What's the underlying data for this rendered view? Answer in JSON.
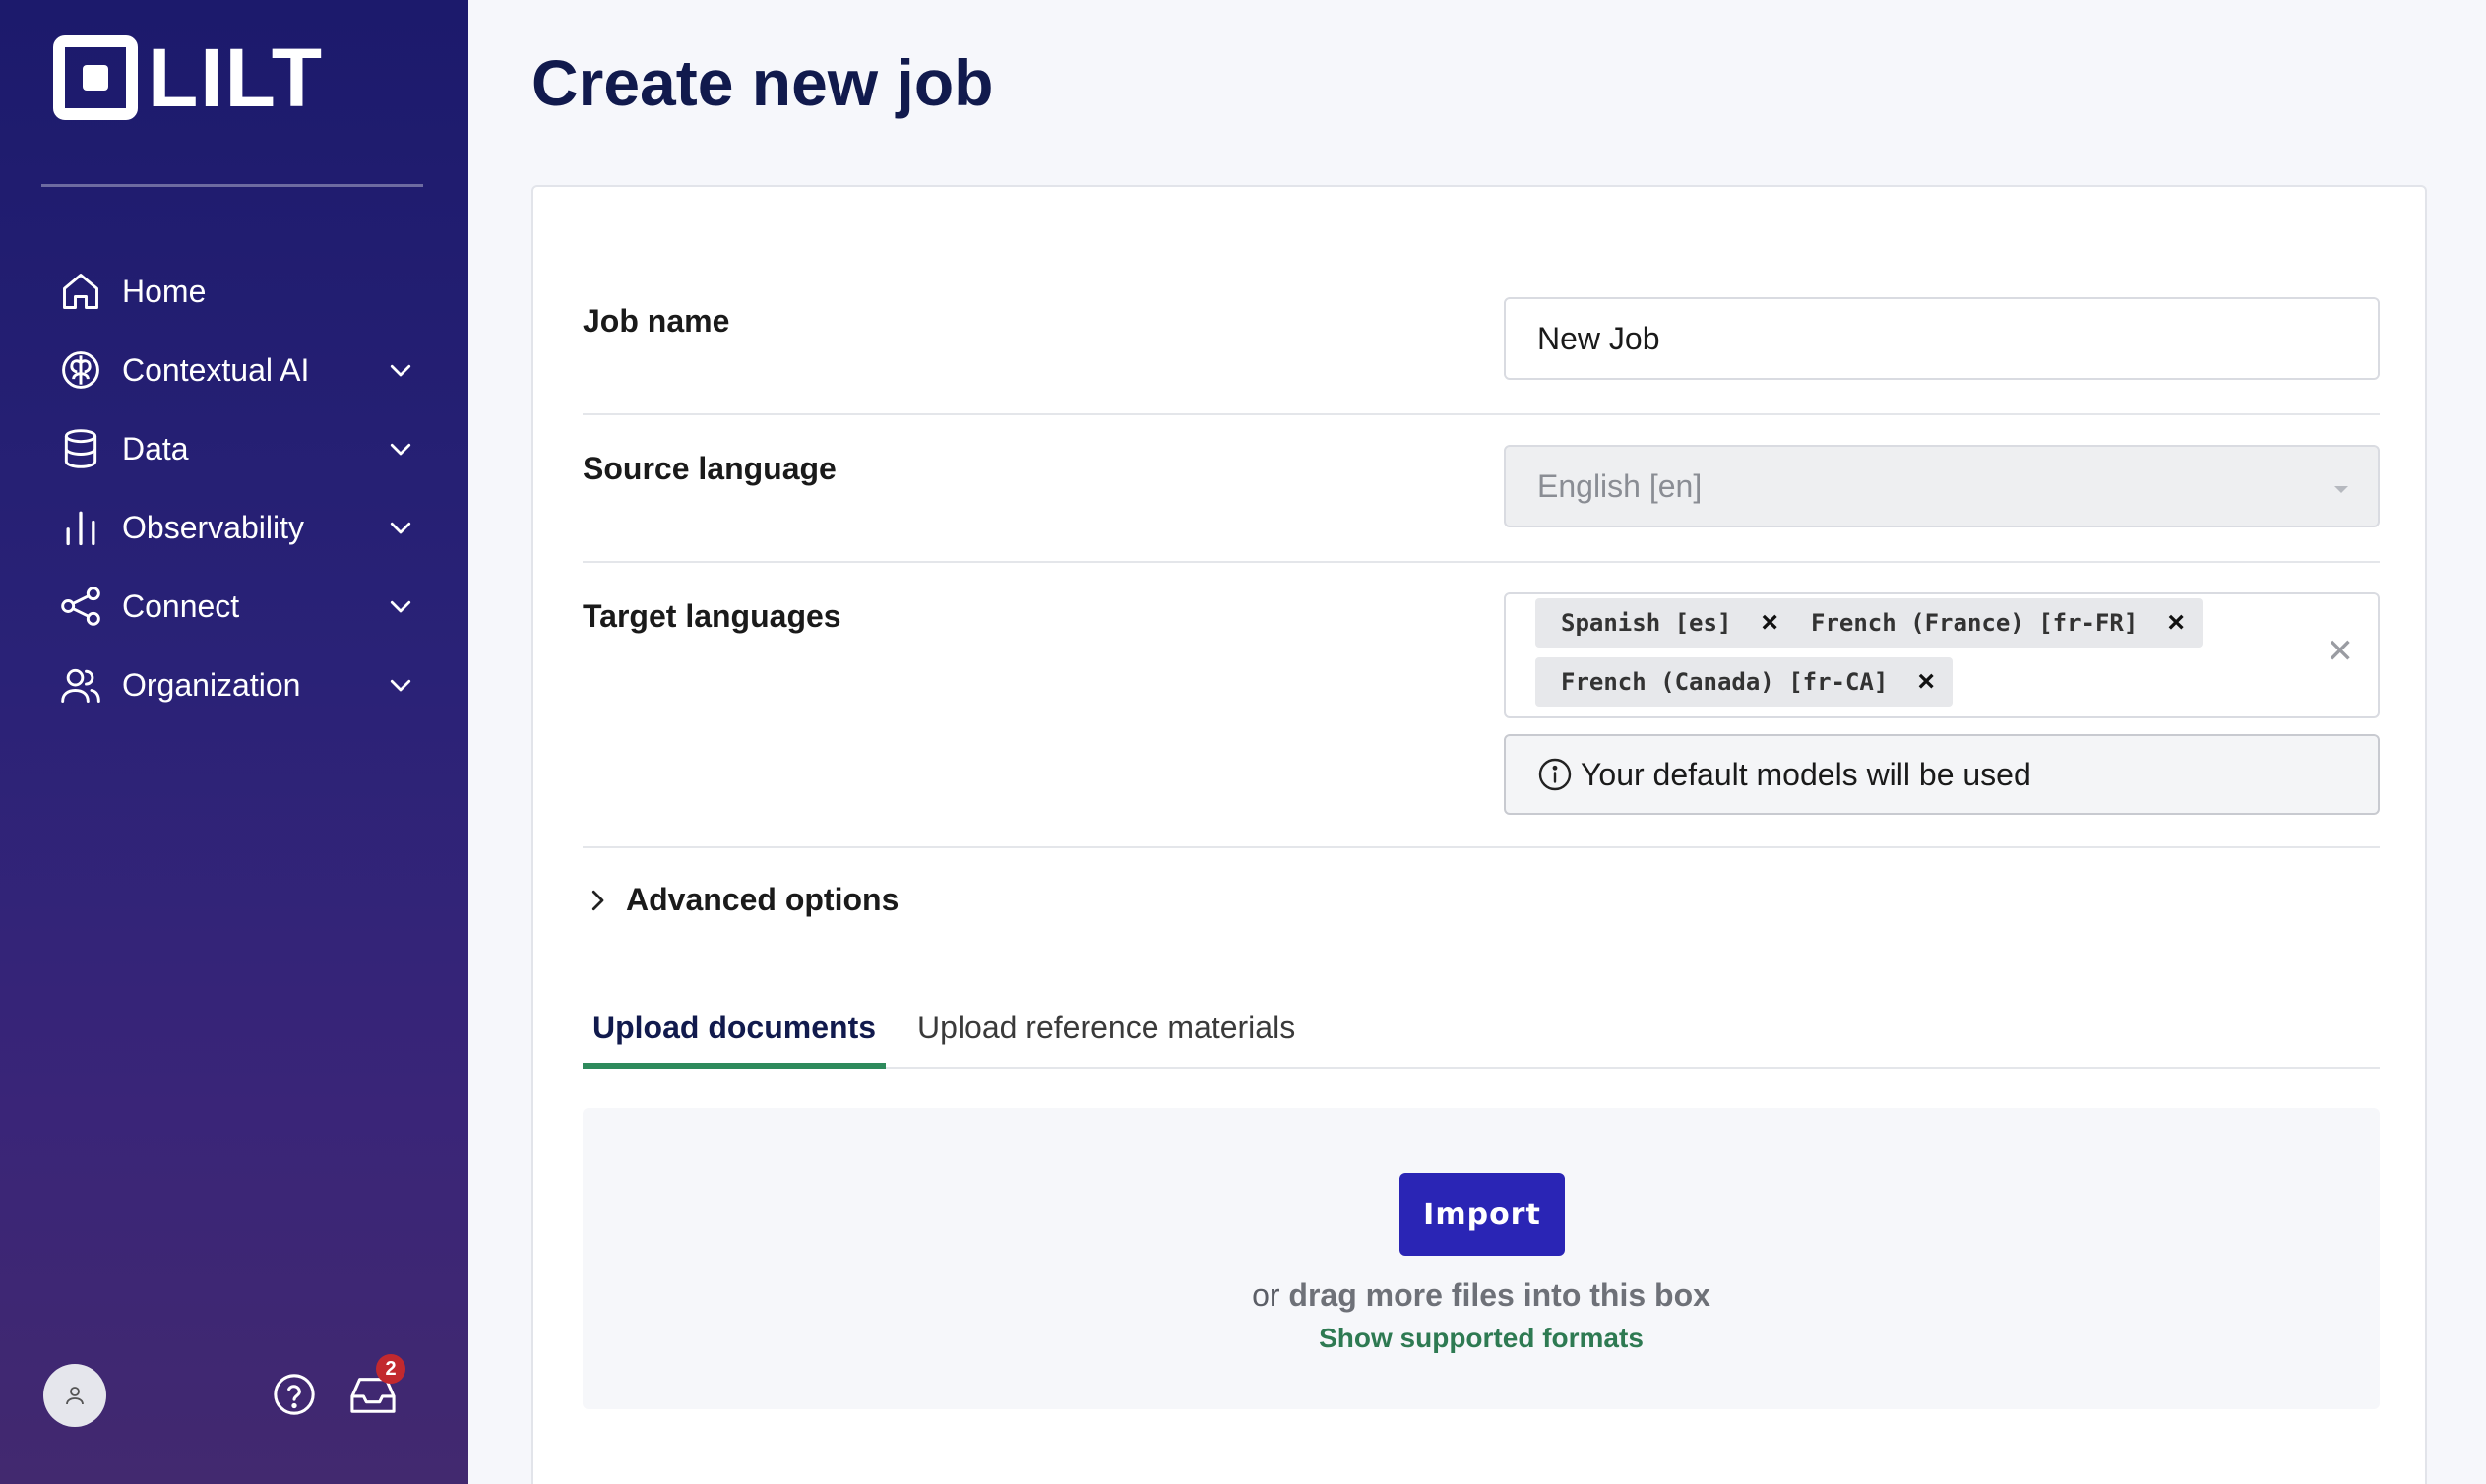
{
  "sidebar": {
    "logo_text": "LILT",
    "items": [
      {
        "label": "Home",
        "icon": "home-icon",
        "expandable": false
      },
      {
        "label": "Contextual AI",
        "icon": "brain-icon",
        "expandable": true
      },
      {
        "label": "Data",
        "icon": "database-icon",
        "expandable": true
      },
      {
        "label": "Observability",
        "icon": "bar-chart-icon",
        "expandable": true
      },
      {
        "label": "Connect",
        "icon": "share-nodes-icon",
        "expandable": true
      },
      {
        "label": "Organization",
        "icon": "users-icon",
        "expandable": true
      }
    ],
    "inbox_badge": "2"
  },
  "page": {
    "title": "Create new job"
  },
  "form": {
    "job_name_label": "Job name",
    "job_name_value": "New Job",
    "source_language_label": "Source language",
    "source_language_value": "English [en]",
    "target_languages_label": "Target languages",
    "target_languages": [
      "Spanish [es]",
      "French (France) [fr-FR]",
      "French (Canada) [fr-CA]"
    ],
    "chip_remove_glyph": "×",
    "clear_glyph": "✕",
    "info_text": "Your default models will be used",
    "advanced_options_label": "Advanced options"
  },
  "tabs": [
    {
      "label": "Upload documents",
      "active": true
    },
    {
      "label": "Upload reference materials",
      "active": false
    }
  ],
  "upload": {
    "import_label": "Import",
    "drag_prefix": "or ",
    "drag_strong": "drag more files into this box",
    "formats_link": "Show supported formats"
  },
  "colors": {
    "accent": "#2a25b5",
    "tab_underline": "#2e8a5c",
    "link": "#2e7a52",
    "badge": "#c2292e",
    "title": "#111a4d"
  }
}
